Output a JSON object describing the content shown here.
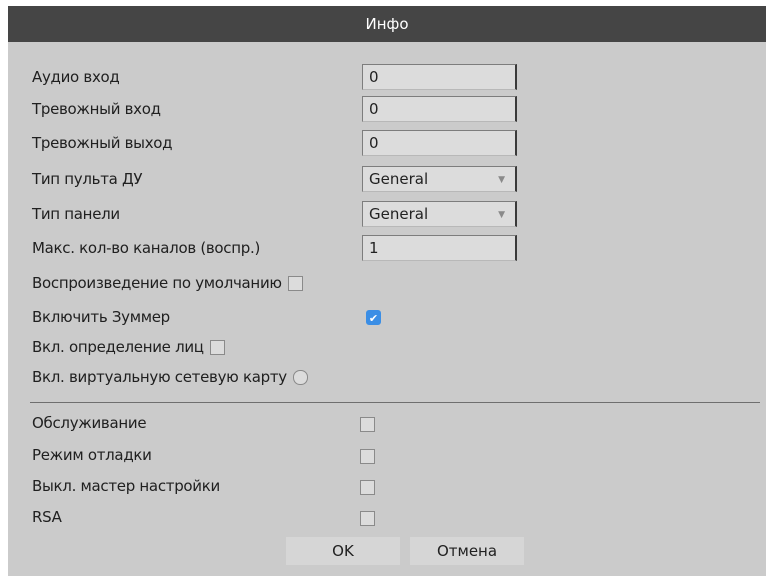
{
  "dialog": {
    "title": "Инфо"
  },
  "fields": [
    {
      "label": "Аудио вход",
      "value": "0"
    },
    {
      "label": "Тревожный вход",
      "value": "0"
    },
    {
      "label": "Тревожный выход",
      "value": "0"
    }
  ],
  "selects": [
    {
      "label": "Тип пульта ДУ",
      "value": "General"
    },
    {
      "label": "Тип панели",
      "value": "General"
    }
  ],
  "max_channels": {
    "label": "Макс. кол-во каналов (воспр.)",
    "value": "1"
  },
  "options": [
    {
      "label": "Воспроизведение по умолчанию",
      "checked": false
    },
    {
      "label": "Включить Зуммер",
      "checked": true
    },
    {
      "label": "Вкл. определение лиц",
      "checked": false
    },
    {
      "label": "Вкл. виртуальную сетевую карту",
      "checked": false
    }
  ],
  "service": [
    {
      "label": "Обслуживание",
      "checked": false
    },
    {
      "label": "Режим отладки",
      "checked": false
    },
    {
      "label": "Выкл. мастер настройки",
      "checked": false
    },
    {
      "label": "RSA",
      "checked": false
    }
  ],
  "buttons": {
    "ok": "OK",
    "cancel": "Отмена"
  },
  "icons": {
    "check": "checkmark-icon",
    "dropdown": "dropdown-arrow-icon"
  },
  "colors": {
    "titlebar": "#454545",
    "panel": "#cbcbcb",
    "checked": "#3b8ee5"
  }
}
